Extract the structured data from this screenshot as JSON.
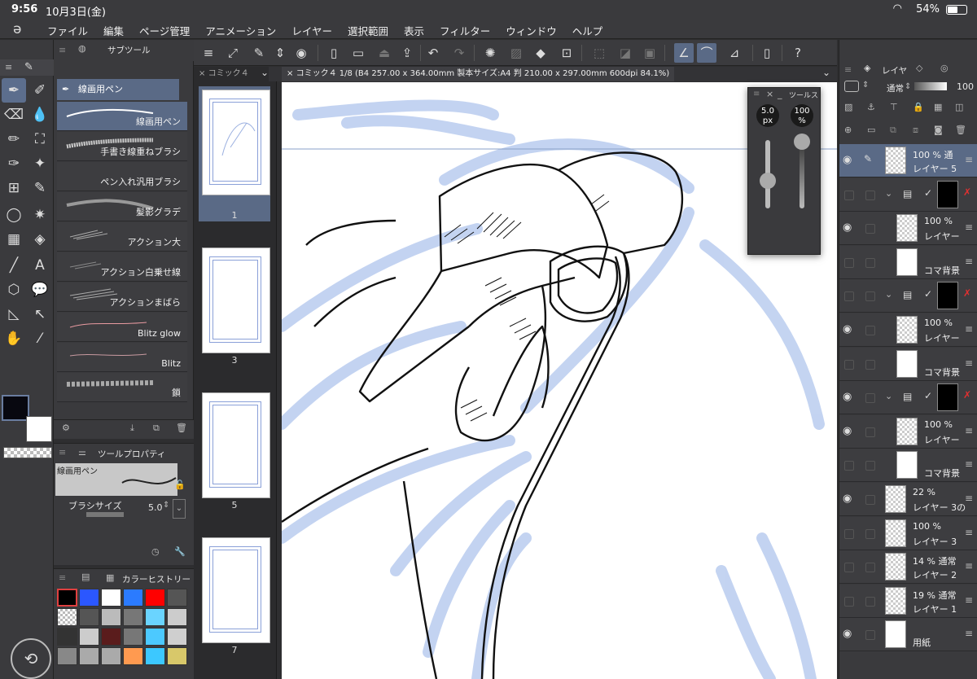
{
  "status": {
    "time": "9:56",
    "date": "10月3日(金)",
    "battery": "54%"
  },
  "menu": [
    "ファイル",
    "編集",
    "ページ管理",
    "アニメーション",
    "レイヤー",
    "選択範囲",
    "表示",
    "フィルター",
    "ウィンドウ",
    "ヘルプ"
  ],
  "subtool": {
    "tab_label": "サブツール",
    "group_label": "線画用ペン",
    "brushes": [
      "線画用ペン",
      "手書き線重ねブラシ",
      "ペン入れ汎用ブラシ",
      "髪影グラデ",
      "アクション大",
      "アクション白乗せ線",
      "アクションまばら",
      "Blitz glow",
      "Blitz",
      "鎖"
    ]
  },
  "toolprop": {
    "tab_label": "ツールプロパティ",
    "preset_label": "線画用ペン",
    "size_label": "ブラシサイズ",
    "size_value": "5.0"
  },
  "colorhist": {
    "tab_label": "カラーヒストリー",
    "colors": [
      "#000000",
      "#2b57ff",
      "#ffffff",
      "#2b7bff",
      "#ff0000",
      "#555555",
      "checker",
      "#555555",
      "#bbbbbb",
      "#777777",
      "#6ad4ff",
      "#cccccc",
      "#333333",
      "#cccccc",
      "#5a1c1c",
      "#777777",
      "#4cc9ff",
      "#cfcfcf",
      "#888888",
      "#aaaaaa",
      "#aaaaaa",
      "#ff9a50",
      "#3cc8ff",
      "#d8c86a"
    ]
  },
  "canvas": {
    "tab_short": "コミック４",
    "tab_full": "コミック４ 1/8 (B4 257.00 x 364.00mm 製本サイズ:A4 判 210.00 x 297.00mm 600dpi 84.1%)"
  },
  "pages": [
    "1",
    "3",
    "5",
    "7"
  ],
  "floatwin": {
    "title": "ツールス",
    "size": "5.0",
    "size_unit": "px",
    "opacity": "100",
    "opacity_unit": "%"
  },
  "layers": {
    "tab_label": "レイヤ",
    "blend": "通常",
    "opacity": "100",
    "rows": [
      {
        "pct": "100 % 通",
        "name": "レイヤー 5"
      },
      {
        "pct": "",
        "name": ""
      },
      {
        "pct": "100 %",
        "name": "レイヤー"
      },
      {
        "pct": "",
        "name": "コマ背景"
      },
      {
        "pct": "",
        "name": ""
      },
      {
        "pct": "100 %",
        "name": "レイヤー"
      },
      {
        "pct": "",
        "name": "コマ背景"
      },
      {
        "pct": "",
        "name": ""
      },
      {
        "pct": "100 %",
        "name": "レイヤー"
      },
      {
        "pct": "",
        "name": "コマ背景"
      },
      {
        "pct": "22 %",
        "name": "レイヤー 3の"
      },
      {
        "pct": "100 %",
        "name": "レイヤー 3"
      },
      {
        "pct": "14 % 通常",
        "name": "レイヤー 2"
      },
      {
        "pct": "19 % 通常",
        "name": "レイヤー 1"
      },
      {
        "pct": "",
        "name": "用紙"
      }
    ]
  }
}
